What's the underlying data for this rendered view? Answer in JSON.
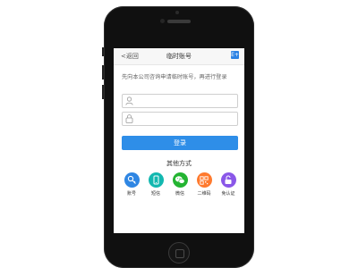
{
  "nav": {
    "back_label": "<返回",
    "title": "临时账号",
    "action_icon": "exit-icon",
    "action_glyph": "E+"
  },
  "notice": "先向本公司咨询申请临时账号，再进行登录",
  "fields": {
    "username": {
      "placeholder": "",
      "icon": "user-icon"
    },
    "password": {
      "placeholder": "",
      "icon": "lock-icon"
    }
  },
  "login_label": "登录",
  "other_title": "其他方式",
  "methods": [
    {
      "label": "账号",
      "icon": "key-icon",
      "color": "#2f86e3"
    },
    {
      "label": "短信",
      "icon": "phone-icon",
      "color": "#13b8b0"
    },
    {
      "label": "微信",
      "icon": "wechat-icon",
      "color": "#24b432"
    },
    {
      "label": "二维码",
      "icon": "qrcode-icon",
      "color": "#ff7a2e"
    },
    {
      "label": "免认证",
      "icon": "unlock-icon",
      "color": "#8a57e8"
    }
  ],
  "colors": {
    "accent": "#2e8ee8",
    "phone_body": "#101010"
  }
}
